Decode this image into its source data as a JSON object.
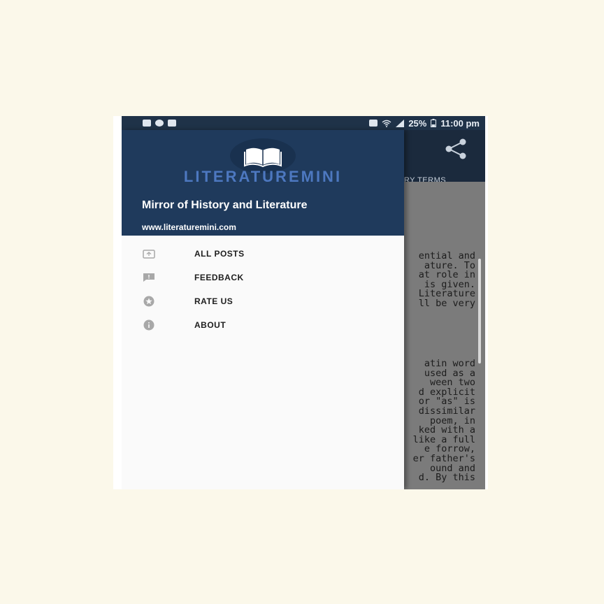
{
  "status_bar": {
    "left_icons": [
      "notification-icon",
      "messenger-icon",
      "image-icon"
    ],
    "right_icons": [
      "alarm-icon",
      "wifi-icon",
      "signal-icon"
    ],
    "battery": "25%",
    "time": "11:00 pm"
  },
  "app": {
    "tab_label": "ARY TERMS",
    "share_icon": "share-icon",
    "paragraph_1": [
      "ential  and",
      "ature.   To",
      "at  role  in",
      "is  given.",
      "Literature",
      "ll  be  very"
    ],
    "paragraph_2": [
      "atin  word",
      "used  as  a",
      "ween  two",
      "d   explicit",
      "or  \"as\"  is",
      "dissimilar",
      "poem,  in",
      "ked  with  a",
      "like  a  full",
      "e  forrow,",
      "er  father's",
      "ound  and",
      "d.  By  this"
    ]
  },
  "drawer": {
    "logo_text": "LITERATUREMINI",
    "title": "Mirror of History and Literature",
    "url": "www.literaturemini.com",
    "menu": [
      {
        "label": "ALL POSTS",
        "icon": "posts-icon"
      },
      {
        "label": "FEEDBACK",
        "icon": "feedback-icon"
      },
      {
        "label": "RATE US",
        "icon": "star-icon"
      },
      {
        "label": "ABOUT",
        "icon": "info-icon"
      }
    ]
  },
  "colors": {
    "page_bg": "#fbf8ea",
    "drawer_header": "#1f3a5c",
    "logo_accent": "#4d78c0",
    "status_bar": "#1f3248"
  }
}
